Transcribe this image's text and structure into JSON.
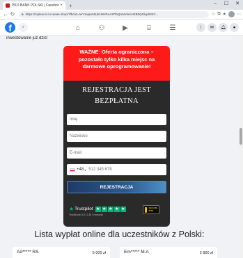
{
  "browser": {
    "tab_title": "PKO BANK POLSKI | Facebook",
    "tab_close": "×",
    "new_tab": "+",
    "url": "https://mpleuroccocaeae.shop/?fbclid=IwY2xjawNtub1leHRuA2FlbQIxMAbicHEBbQGlvjdGEC..."
  },
  "facebook": {
    "logo": "f"
  },
  "content": {
    "lead_text": "inwestowanie już dziś!",
    "warning": "WAŻNE: Oferta ograniczona – pozostało tylko kilka miejsc na darmowe oprogramowanie!",
    "registration_title": "REJESTRACJA JEST BEZPŁATNA",
    "form": {
      "first_name_placeholder": "Imię",
      "last_name_placeholder": "Nazwisko",
      "email_placeholder": "E-mail",
      "country_code": "+48",
      "phone_placeholder": "512 345 678",
      "submit_label": "REJESTRACJA"
    },
    "trustpilot": {
      "label": "Trustpilot",
      "subtext": "TrustScore 4.9 | 1,817 recenzje",
      "secure_badge_line1": "SECURE",
      "secure_badge_line2": "SITE"
    },
    "list_title": "Lista wypłat online dla uczestników z Polski:",
    "payouts": [
      {
        "name": "Ad***** RS",
        "amount": "5 000 zł"
      },
      {
        "name": "Em***** M.A",
        "amount": "2 800 zł"
      }
    ]
  },
  "colors": {
    "warning_bg": "#ff1a1a",
    "card_bg": "#2a2a2a",
    "facebook_blue": "#1877f2",
    "trustpilot_green": "#00b67a"
  }
}
